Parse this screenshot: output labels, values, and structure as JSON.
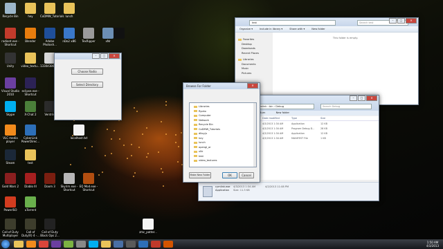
{
  "desktop_icons": [
    {
      "label": "Recycle Bin",
      "color": "#9db7c9"
    },
    {
      "label": "hey",
      "color": "#e9c35a"
    },
    {
      "label": "CoDMW_Tutorials",
      "color": "#e9c35a"
    },
    {
      "label": "lunch",
      "color": "#e9c35a"
    },
    {
      "label": "radiant.exe - Shortcut",
      "color": "#c23b2b"
    },
    {
      "label": "Blender",
      "color": "#e87d0d"
    },
    {
      "label": "Adobe Photosh...",
      "color": "#1f4f9a"
    },
    {
      "label": "nDo2 x86",
      "color": "#3a78c9"
    },
    {
      "label": "TexRipper",
      "color": "#9a9a9a"
    },
    {
      "label": "xNr",
      "color": "#6c8fb5"
    },
    {
      "label": "",
      "color": "#111111"
    },
    {
      "label": "Unity",
      "color": "#333333"
    },
    {
      "label": "video_textu...",
      "color": "#e9c35a"
    },
    {
      "label": "1330438640...",
      "color": "#d8d8d8"
    },
    {
      "label": "Visual Studio 2010",
      "color": "#6b3fa0"
    },
    {
      "label": "eclipse.exe - Shortcut",
      "color": "#2c2255"
    },
    {
      "label": "Skype",
      "color": "#00aff0"
    },
    {
      "label": "X-Chat 2",
      "color": "#4b7f3a"
    },
    {
      "label": "Ventrilo",
      "color": "#2b2b2b"
    },
    {
      "label": "VLC media player",
      "color": "#f28b1c"
    },
    {
      "label": "CyberLink PowerDirec...",
      "color": "#2d6fb8"
    },
    {
      "label": "localhost.txt",
      "color": "#f4f4f4"
    },
    {
      "label": "Steam",
      "color": "#1b2838"
    },
    {
      "label": "test",
      "color": "#e9c35a"
    },
    {
      "label": "Gold Wars 2",
      "color": "#8a1f1f"
    },
    {
      "label": "Diablo III",
      "color": "#a51f1f"
    },
    {
      "label": "Doom 3",
      "color": "#7a1e10"
    },
    {
      "label": "Skyrim.exe - Shortcut",
      "color": "#b7b7b7"
    },
    {
      "label": "EQ Mod.exe - Shortcut",
      "color": "#b34e10"
    },
    {
      "label": "PowerISO",
      "color": "#d23c1f"
    },
    {
      "label": "uTorrent",
      "color": "#6ab04c"
    },
    {
      "label": "Call of Duty Multiplayer",
      "color": "#3d3d2c"
    },
    {
      "label": "Call of Duty(R) 4 -...",
      "color": "#3d3d2c"
    },
    {
      "label": "Call of Duty Black Ops 2...",
      "color": "#222222"
    },
    {
      "label": "zmc_patter...",
      "color": "#f4f4f4"
    }
  ],
  "small_form": {
    "choose_radio": "Choose Radio",
    "select_directory": "Select Directory"
  },
  "explorer_top": {
    "breadcrumb": "test",
    "toolbar": [
      "Organize ▾",
      "Include in library ▾",
      "Share with ▾",
      "New folder"
    ],
    "search_placeholder": "Search test",
    "empty_message": "This folder is empty.",
    "nav": [
      "Favorites",
      "Desktop",
      "Downloads",
      "Recent Places",
      "Libraries",
      "Documents",
      "Music",
      "Pictures"
    ]
  },
  "browse_dialog": {
    "title": "Browse For Folder",
    "tree": [
      "Libraries",
      "Ryoko",
      "Computer",
      "Network",
      "Recycle Bin",
      "CoDMW_Tutorials",
      "dlloy.js",
      "hey",
      "lunch",
      "opengl_ar",
      "xNr",
      "test",
      "video_textures"
    ],
    "make_new_folder": "Make New Folder",
    "ok": "OK",
    "cancel": "Cancel"
  },
  "explorer_debug": {
    "breadcrumb": "« cymlink › bin › Debug",
    "search_placeholder": "Search Debug",
    "toolbar": [
      "Burn",
      "New folder"
    ],
    "columns": [
      "Date modified",
      "Type",
      "Size"
    ],
    "rows": [
      {
        "name": "",
        "date": "4/3/2013 1:34 AM",
        "type": "Application",
        "size": "12 KB"
      },
      {
        "name": "",
        "date": "4/3/2013 1:34 AM",
        "type": "Program Debug D...",
        "size": "28 KB"
      },
      {
        "name": "...ase",
        "date": "4/3/2013 1:34 AM",
        "type": "Application",
        "size": "12 KB"
      },
      {
        "name": "...ase.manifest",
        "date": "4/3/2013 1:34 AM",
        "type": "MANIFEST File",
        "size": "1 KB"
      }
    ],
    "drive": "New Volume (E:)",
    "file_name": "cymlink.exe",
    "file_date": "4/3/2013 1:34 AM",
    "file_created": "4/2/2013 11:08 PM",
    "file_type": "Application",
    "file_size": "Size: 11.5 KB"
  },
  "clock": {
    "time": "1:50 AM",
    "date": "4/3/2013"
  }
}
